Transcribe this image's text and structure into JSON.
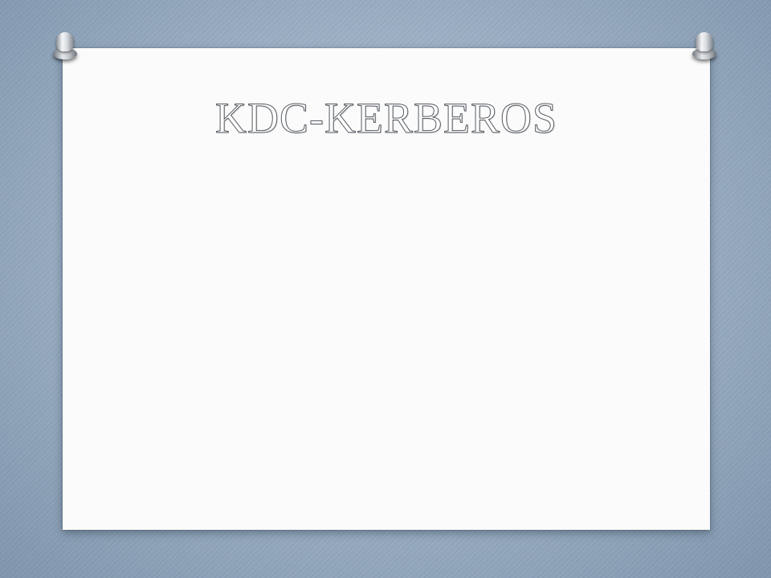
{
  "slide": {
    "title": "KDC-KERBEROS"
  },
  "colors": {
    "background": "#9fb2c6",
    "paper": "#fbfbfb",
    "title_outline": "#555a60"
  },
  "icons": [
    "pushpin-icon",
    "pushpin-icon"
  ]
}
